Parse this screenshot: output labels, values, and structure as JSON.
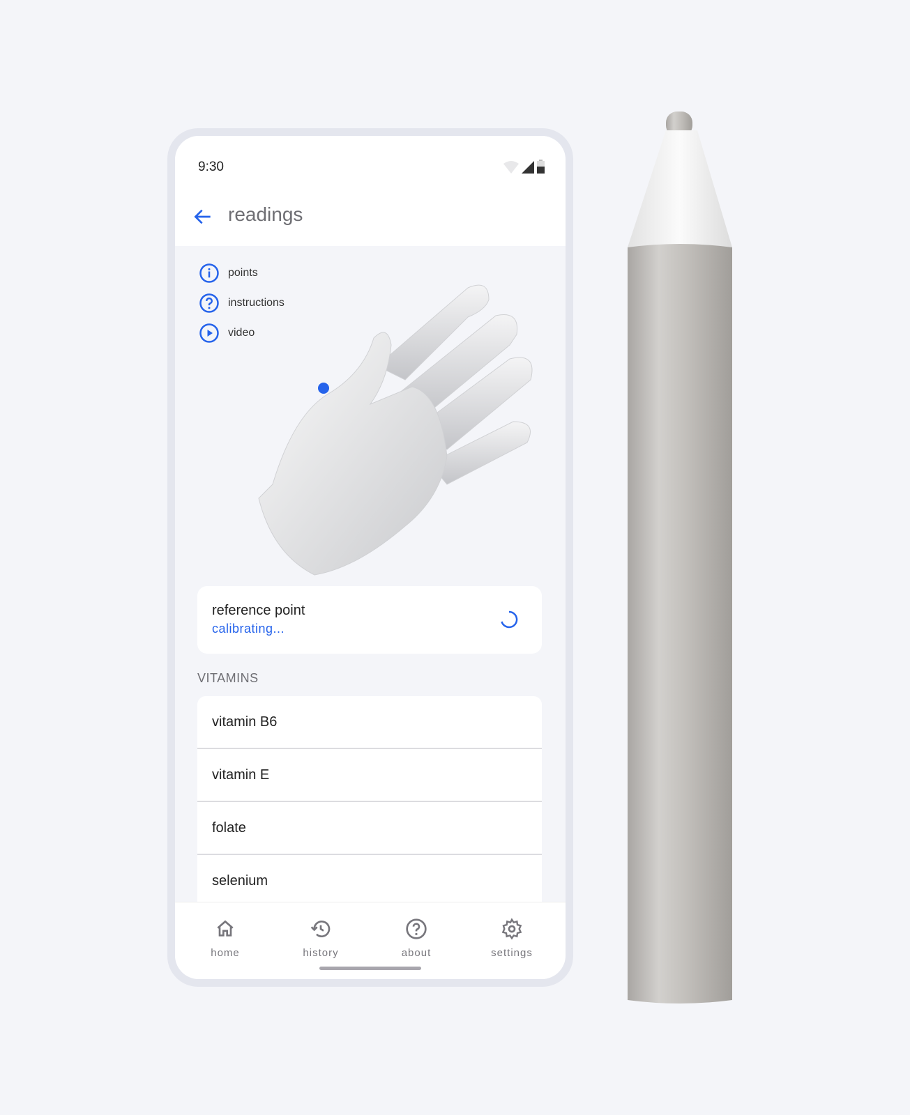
{
  "status_bar": {
    "time": "9:30",
    "icons": [
      "wifi-icon",
      "signal-icon",
      "battery-icon"
    ]
  },
  "app_bar": {
    "title": "readings",
    "back_icon": "arrow-left-icon"
  },
  "links": [
    {
      "label": "points",
      "icon": "info-icon"
    },
    {
      "label": "instructions",
      "icon": "help-icon"
    },
    {
      "label": "video",
      "icon": "play-icon"
    }
  ],
  "reference_card": {
    "title": "reference point",
    "status": "calibrating..."
  },
  "vitamins": {
    "header": "VITAMINS",
    "items": [
      "vitamin B6",
      "vitamin E",
      "folate",
      "selenium"
    ]
  },
  "bottom_nav": [
    {
      "label": "home",
      "icon": "home-icon"
    },
    {
      "label": "history",
      "icon": "history-icon"
    },
    {
      "label": "about",
      "icon": "help-icon"
    },
    {
      "label": "settings",
      "icon": "gear-icon"
    }
  ],
  "colors": {
    "accent": "#2563eb",
    "background": "#f4f5f9"
  }
}
